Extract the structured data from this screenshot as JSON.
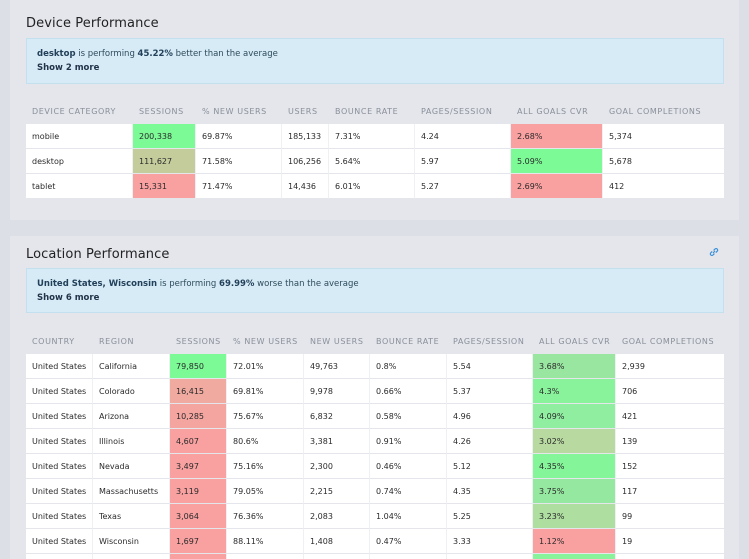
{
  "device": {
    "title": "Device Performance",
    "insight": {
      "segment": "desktop",
      "text_mid": " is performing ",
      "pct": "45.22%",
      "text_end": " better than the average",
      "more": "Show 2 more"
    },
    "columns": [
      "DEVICE CATEGORY",
      "SESSIONS",
      "% NEW USERS",
      "USERS",
      "BOUNCE RATE",
      "PAGES/SESSION",
      "ALL GOALS CVR",
      "GOAL COMPLETIONS"
    ],
    "rows": [
      {
        "cells": [
          "mobile",
          "200,338",
          "69.87%",
          "185,133",
          "7.31%",
          "4.24",
          "2.68%",
          "5,374"
        ],
        "sessions_color": "#7bfa96",
        "cvr_color": "#f9a0a0"
      },
      {
        "cells": [
          "desktop",
          "111,627",
          "71.58%",
          "106,256",
          "5.64%",
          "5.97",
          "5.09%",
          "5,678"
        ],
        "sessions_color": "#c5cc9c",
        "cvr_color": "#7bfa96"
      },
      {
        "cells": [
          "tablet",
          "15,331",
          "71.47%",
          "14,436",
          "6.01%",
          "5.27",
          "2.69%",
          "412"
        ],
        "sessions_color": "#f9a0a0",
        "cvr_color": "#f9a0a0"
      }
    ]
  },
  "location": {
    "title": "Location Performance",
    "link_icon": "link-icon",
    "insight": {
      "segment": "United States, Wisconsin",
      "text_mid": " is performing ",
      "pct": "69.99%",
      "text_end": " worse than the average",
      "more": "Show 6 more"
    },
    "columns": [
      "COUNTRY",
      "REGION",
      "SESSIONS",
      "% NEW USERS",
      "NEW USERS",
      "BOUNCE RATE",
      "PAGES/SESSION",
      "ALL GOALS CVR",
      "GOAL COMPLETIONS"
    ],
    "rows": [
      {
        "cells": [
          "United States",
          "California",
          "79,850",
          "72.01%",
          "49,763",
          "0.8%",
          "5.54",
          "3.68%",
          "2,939"
        ],
        "sessions_color": "#7bfa96",
        "cvr_color": "#99e6a0"
      },
      {
        "cells": [
          "United States",
          "Colorado",
          "16,415",
          "69.81%",
          "9,978",
          "0.66%",
          "5.37",
          "4.3%",
          "706"
        ],
        "sessions_color": "#f0aaa0",
        "cvr_color": "#88f39a"
      },
      {
        "cells": [
          "United States",
          "Arizona",
          "10,285",
          "75.67%",
          "6,832",
          "0.58%",
          "4.96",
          "4.09%",
          "421"
        ],
        "sessions_color": "#f5a5a0",
        "cvr_color": "#90eea0"
      },
      {
        "cells": [
          "United States",
          "Illinois",
          "4,607",
          "80.6%",
          "3,381",
          "0.91%",
          "4.26",
          "3.02%",
          "139"
        ],
        "sessions_color": "#f9a0a0",
        "cvr_color": "#b8d9a0"
      },
      {
        "cells": [
          "United States",
          "Nevada",
          "3,497",
          "75.16%",
          "2,300",
          "0.46%",
          "5.12",
          "4.35%",
          "152"
        ],
        "sessions_color": "#f9a0a0",
        "cvr_color": "#84f598"
      },
      {
        "cells": [
          "United States",
          "Massachusetts",
          "3,119",
          "79.05%",
          "2,215",
          "0.74%",
          "4.35",
          "3.75%",
          "117"
        ],
        "sessions_color": "#f9a0a0",
        "cvr_color": "#95e8a0"
      },
      {
        "cells": [
          "United States",
          "Texas",
          "3,064",
          "76.36%",
          "2,083",
          "1.04%",
          "5.25",
          "3.23%",
          "99"
        ],
        "sessions_color": "#f9a0a0",
        "cvr_color": "#aedfa0"
      },
      {
        "cells": [
          "United States",
          "Wisconsin",
          "1,697",
          "88.11%",
          "1,408",
          "0.47%",
          "3.33",
          "1.12%",
          "19"
        ],
        "sessions_color": "#f9a0a0",
        "cvr_color": "#f9a0a0"
      },
      {
        "cells": [
          "",
          "",
          "",
          "",
          "",
          "",
          "",
          "",
          ""
        ],
        "sessions_color": "#f9a0a0",
        "cvr_color": "#88f39a"
      }
    ]
  }
}
